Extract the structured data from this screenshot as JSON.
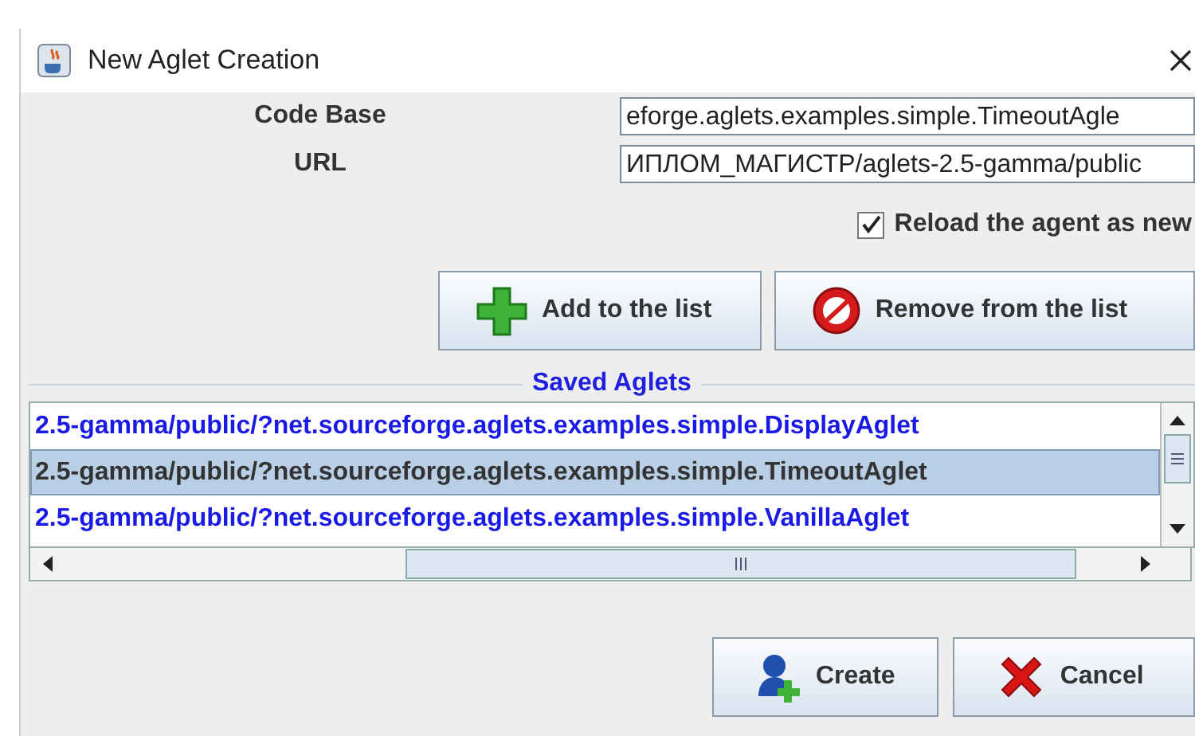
{
  "window": {
    "title": "New Aglet Creation"
  },
  "fields": [
    {
      "label": "Code Base",
      "value": "eforge.aglets.examples.simple.TimeoutAgle"
    },
    {
      "label": "URL",
      "value": "ИПЛОМ_МАГИСТР/aglets-2.5-gamma/public"
    }
  ],
  "reload_checkbox": {
    "label": "Reload the agent as new",
    "checked": true
  },
  "list_buttons": [
    {
      "kind": "add",
      "label": "Add to the list"
    },
    {
      "kind": "remove",
      "label": "Remove from the list"
    }
  ],
  "saved_aglets": {
    "title": "Saved Aglets",
    "items": [
      {
        "text": "2.5-gamma/public/?net.sourceforge.aglets.examples.simple.DisplayAglet",
        "selected": false
      },
      {
        "text": "2.5-gamma/public/?net.sourceforge.aglets.examples.simple.TimeoutAglet",
        "selected": true
      },
      {
        "text": "2.5-gamma/public/?net.sourceforge.aglets.examples.simple.VanillaAglet",
        "selected": false
      }
    ]
  },
  "dialog_buttons": [
    {
      "kind": "create",
      "label": "Create"
    },
    {
      "kind": "cancel",
      "label": "Cancel"
    }
  ]
}
